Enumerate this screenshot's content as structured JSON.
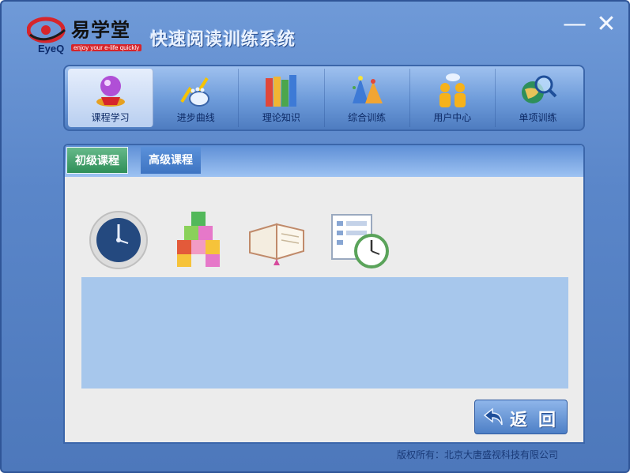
{
  "header": {
    "logo_name": "易学堂",
    "logo_eyeq": "EyeQ",
    "logo_tagline": "enjoy your e-life quickly",
    "app_title": "快速阅读训练系统",
    "minimize_glyph": "—",
    "close_glyph": "✕"
  },
  "toolbar": {
    "items": [
      {
        "label": "课程学习",
        "icon": "wizard-hat-icon",
        "active": true
      },
      {
        "label": "进步曲线",
        "icon": "footprint-chart-icon",
        "active": false
      },
      {
        "label": "理论知识",
        "icon": "books-icon",
        "active": false
      },
      {
        "label": "综合训练",
        "icon": "party-hats-icon",
        "active": false
      },
      {
        "label": "用户中心",
        "icon": "users-icon",
        "active": false
      },
      {
        "label": "单项训练",
        "icon": "globe-magnifier-icon",
        "active": false
      }
    ]
  },
  "tabs": [
    {
      "label": "初级课程",
      "selected": true
    },
    {
      "label": "高级课程",
      "selected": false
    }
  ],
  "courses": [
    {
      "icon": "clock-icon"
    },
    {
      "icon": "colored-blocks-icon"
    },
    {
      "icon": "open-book-icon"
    },
    {
      "icon": "document-clock-icon"
    }
  ],
  "back_button": {
    "label": "返回"
  },
  "footer": {
    "copyright": "版权所有：北京大唐盛视科技有限公司"
  },
  "colors": {
    "window_bg": "#5a86c9",
    "panel_bg": "#ececec",
    "info_box": "#a7c7ec",
    "active_tab": "#2f8f58",
    "logo_red": "#d6252b"
  }
}
